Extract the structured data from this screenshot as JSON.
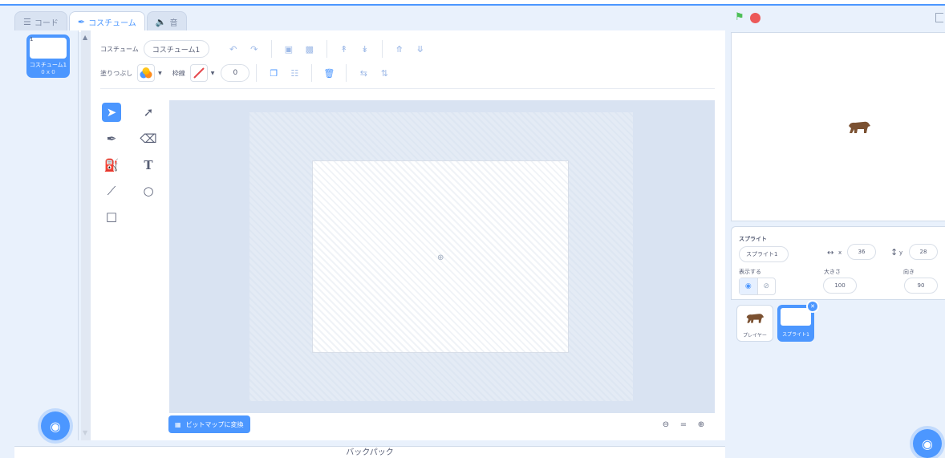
{
  "tabs": [
    {
      "label": "コード",
      "icon": "code-icon"
    },
    {
      "label": "コスチューム",
      "icon": "brush-icon"
    },
    {
      "label": "音",
      "icon": "speaker-icon"
    }
  ],
  "costumes": [
    {
      "index": "1",
      "name": "コスチューム1",
      "size": "0 x 0"
    }
  ],
  "toolbar": {
    "costume_label": "コスチューム",
    "costume_name": "コスチューム1",
    "fill_label": "塗りつぶし",
    "outline_label": "枠線",
    "outline_width": "0"
  },
  "tools": [
    "select-icon",
    "reshape-icon",
    "brush-icon",
    "eraser-icon",
    "fill-icon",
    "text-icon",
    "line-icon",
    "circle-icon",
    "rectangle-icon"
  ],
  "bitmap_button": "ビットマップに変換",
  "zoom": {
    "out": "-",
    "reset": "=",
    "in": "+"
  },
  "backpack_label": "バックパック",
  "sprite_info": {
    "sprite_label": "スプライト",
    "sprite_name": "スプライト1",
    "x_label": "x",
    "x_value": "36",
    "y_label": "y",
    "y_value": "28",
    "show_label": "表示する",
    "size_label": "大きさ",
    "size_value": "100",
    "direction_label": "向き",
    "direction_value": "90"
  },
  "sprites": [
    {
      "name": "プレイヤー"
    },
    {
      "name": "スプライト1"
    }
  ],
  "colors": {
    "accent": "#4c97ff",
    "flag": "#4cbf56",
    "stop": "#ec5959",
    "bear": "#7b5131"
  }
}
